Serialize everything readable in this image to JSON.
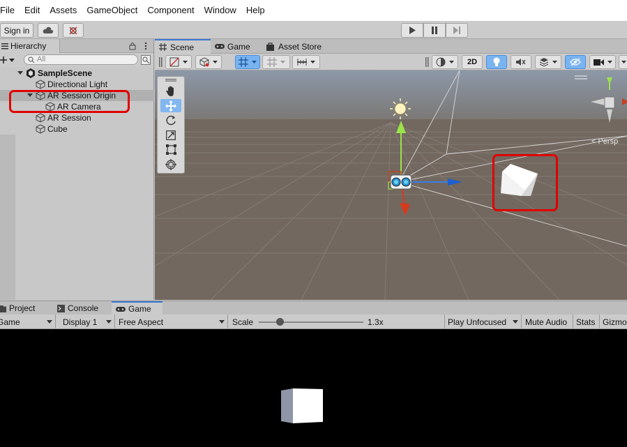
{
  "menu": [
    "File",
    "Edit",
    "Assets",
    "GameObject",
    "Component",
    "Window",
    "Help"
  ],
  "toolbar": {
    "sign_in": "Sign in"
  },
  "hierarchy": {
    "tab_label": "Hierarchy",
    "search_placeholder": "All",
    "items": [
      {
        "label": "SampleScene",
        "bold": true
      },
      {
        "label": "Directional Light"
      },
      {
        "label": "AR Session Origin"
      },
      {
        "label": "AR Camera"
      },
      {
        "label": "AR Session"
      },
      {
        "label": "Cube"
      }
    ]
  },
  "scene": {
    "tabs": [
      "Scene",
      "Game",
      "Asset Store"
    ],
    "btn_2d": "2D",
    "persp_label": "< Persp"
  },
  "bottom": {
    "tabs": [
      "Project",
      "Console",
      "Game"
    ]
  },
  "game_toolbar": {
    "view": "Game",
    "display": "Display 1",
    "aspect": "Free Aspect",
    "scale_label": "Scale",
    "scale_value": "1.3x",
    "play_mode": "Play Unfocused",
    "mute": "Mute Audio",
    "stats": "Stats",
    "gizmos": "Gizmos"
  },
  "colors": {
    "highlight": "#e00000",
    "selection": "#b0b0b0",
    "accent": "#3a79d6"
  }
}
